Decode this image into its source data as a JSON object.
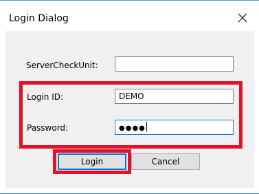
{
  "window": {
    "title": "Login Dialog",
    "close_icon": "close-icon"
  },
  "form": {
    "server_label": "ServerCheckUnit:",
    "server_value": "",
    "login_label": "Login ID:",
    "login_value": "DEMO",
    "password_label": "Password:",
    "password_masked": "●●●●"
  },
  "buttons": {
    "login_label": "Login",
    "cancel_label": "Cancel"
  },
  "colors": {
    "highlight": "#e3112a",
    "focus": "#1e78d4",
    "dialog_background": "#f0f0f0"
  }
}
